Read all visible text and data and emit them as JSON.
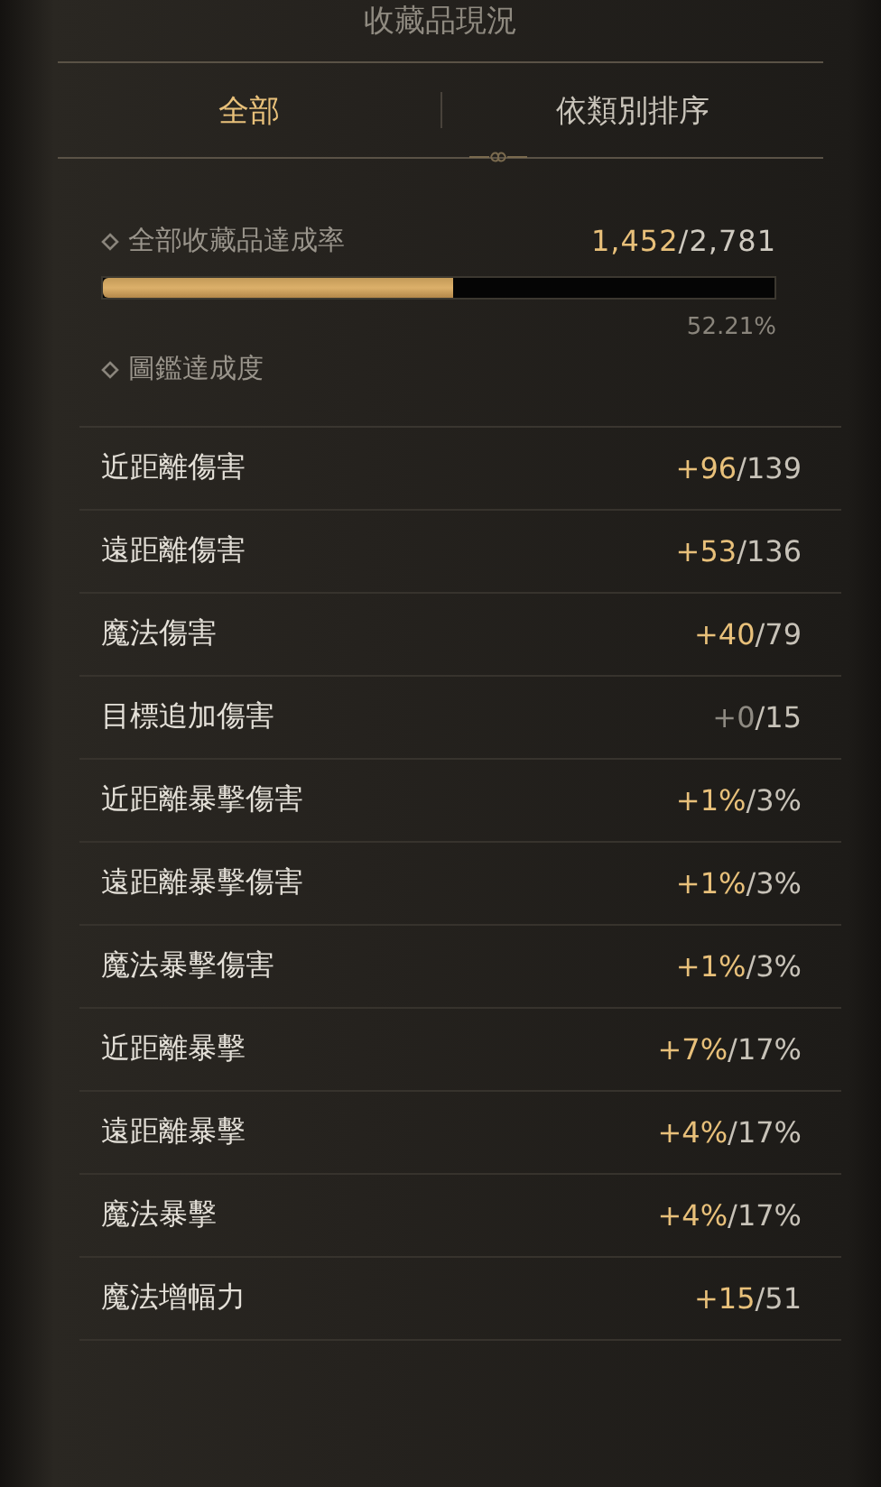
{
  "title": "收藏品現況",
  "tabs": [
    {
      "label": "全部",
      "selected": true
    },
    {
      "label": "依類別排序",
      "selected": false
    }
  ],
  "overall": {
    "label": "全部收藏品達成率",
    "count": "1,452",
    "total": "/2,781",
    "level": 0.5221,
    "percent": "52.21%"
  },
  "codex": {
    "label": "圖鑑達成度"
  },
  "stats": [
    {
      "name": "近距離傷害",
      "gain": "+96",
      "max": "/139",
      "active": true
    },
    {
      "name": "遠距離傷害",
      "gain": "+53",
      "max": "/136",
      "active": true
    },
    {
      "name": "魔法傷害",
      "gain": "+40",
      "max": "/79",
      "active": true
    },
    {
      "name": "目標追加傷害",
      "gain": "+0",
      "max": "/15",
      "active": false
    },
    {
      "name": "近距離暴擊傷害",
      "gain": "+1%",
      "max": "/3%",
      "active": true
    },
    {
      "name": "遠距離暴擊傷害",
      "gain": "+1%",
      "max": "/3%",
      "active": true
    },
    {
      "name": "魔法暴擊傷害",
      "gain": "+1%",
      "max": "/3%",
      "active": true
    },
    {
      "name": "近距離暴擊",
      "gain": "+7%",
      "max": "/17%",
      "active": true
    },
    {
      "name": "遠距離暴擊",
      "gain": "+4%",
      "max": "/17%",
      "active": true
    },
    {
      "name": "魔法暴擊",
      "gain": "+4%",
      "max": "/17%",
      "active": true
    },
    {
      "name": "魔法增幅力",
      "gain": "+15",
      "max": "/51",
      "active": true
    }
  ]
}
